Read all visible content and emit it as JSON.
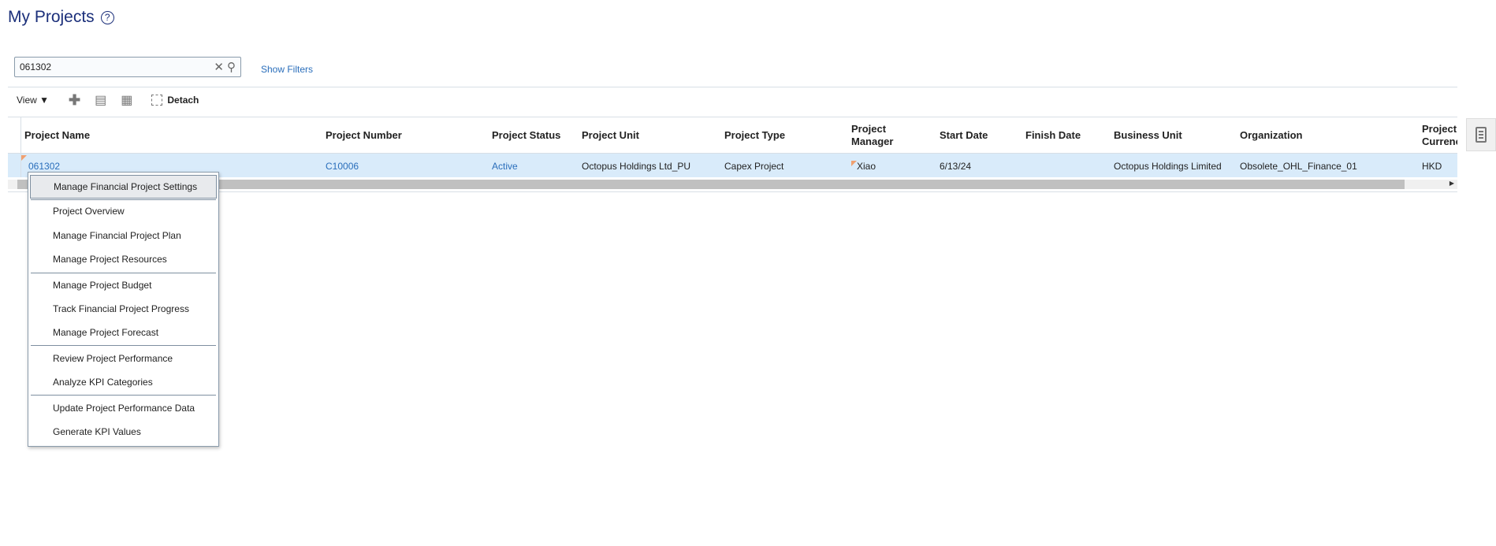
{
  "page": {
    "title": "My Projects"
  },
  "search": {
    "value": "061302",
    "show_filters": "Show Filters"
  },
  "toolbar": {
    "view": "View",
    "detach": "Detach"
  },
  "table": {
    "columns": [
      "Project Name",
      "Project Number",
      "Project Status",
      "Project Unit",
      "Project Type",
      "Project Manager",
      "Start Date",
      "Finish Date",
      "Business Unit",
      "Organization",
      "Project Currency"
    ],
    "rows": [
      {
        "name": "061302",
        "number": "C10006",
        "status": "Active",
        "unit": "Octopus Holdings Ltd_PU",
        "type": "Capex Project",
        "manager": "Xiao",
        "start": "6/13/24",
        "finish": "",
        "bu": "Octopus Holdings Limited",
        "org": "Obsolete_OHL_Finance_01",
        "currency": "HKD"
      }
    ]
  },
  "menu": {
    "items": [
      "Manage Financial Project Settings",
      "Project Overview",
      "Manage Financial Project Plan",
      "Manage Project Resources",
      "Manage Project Budget",
      "Track Financial Project Progress",
      "Manage Project Forecast",
      "Review Project Performance",
      "Analyze KPI Categories",
      "Update Project Performance Data",
      "Generate KPI Values"
    ]
  }
}
